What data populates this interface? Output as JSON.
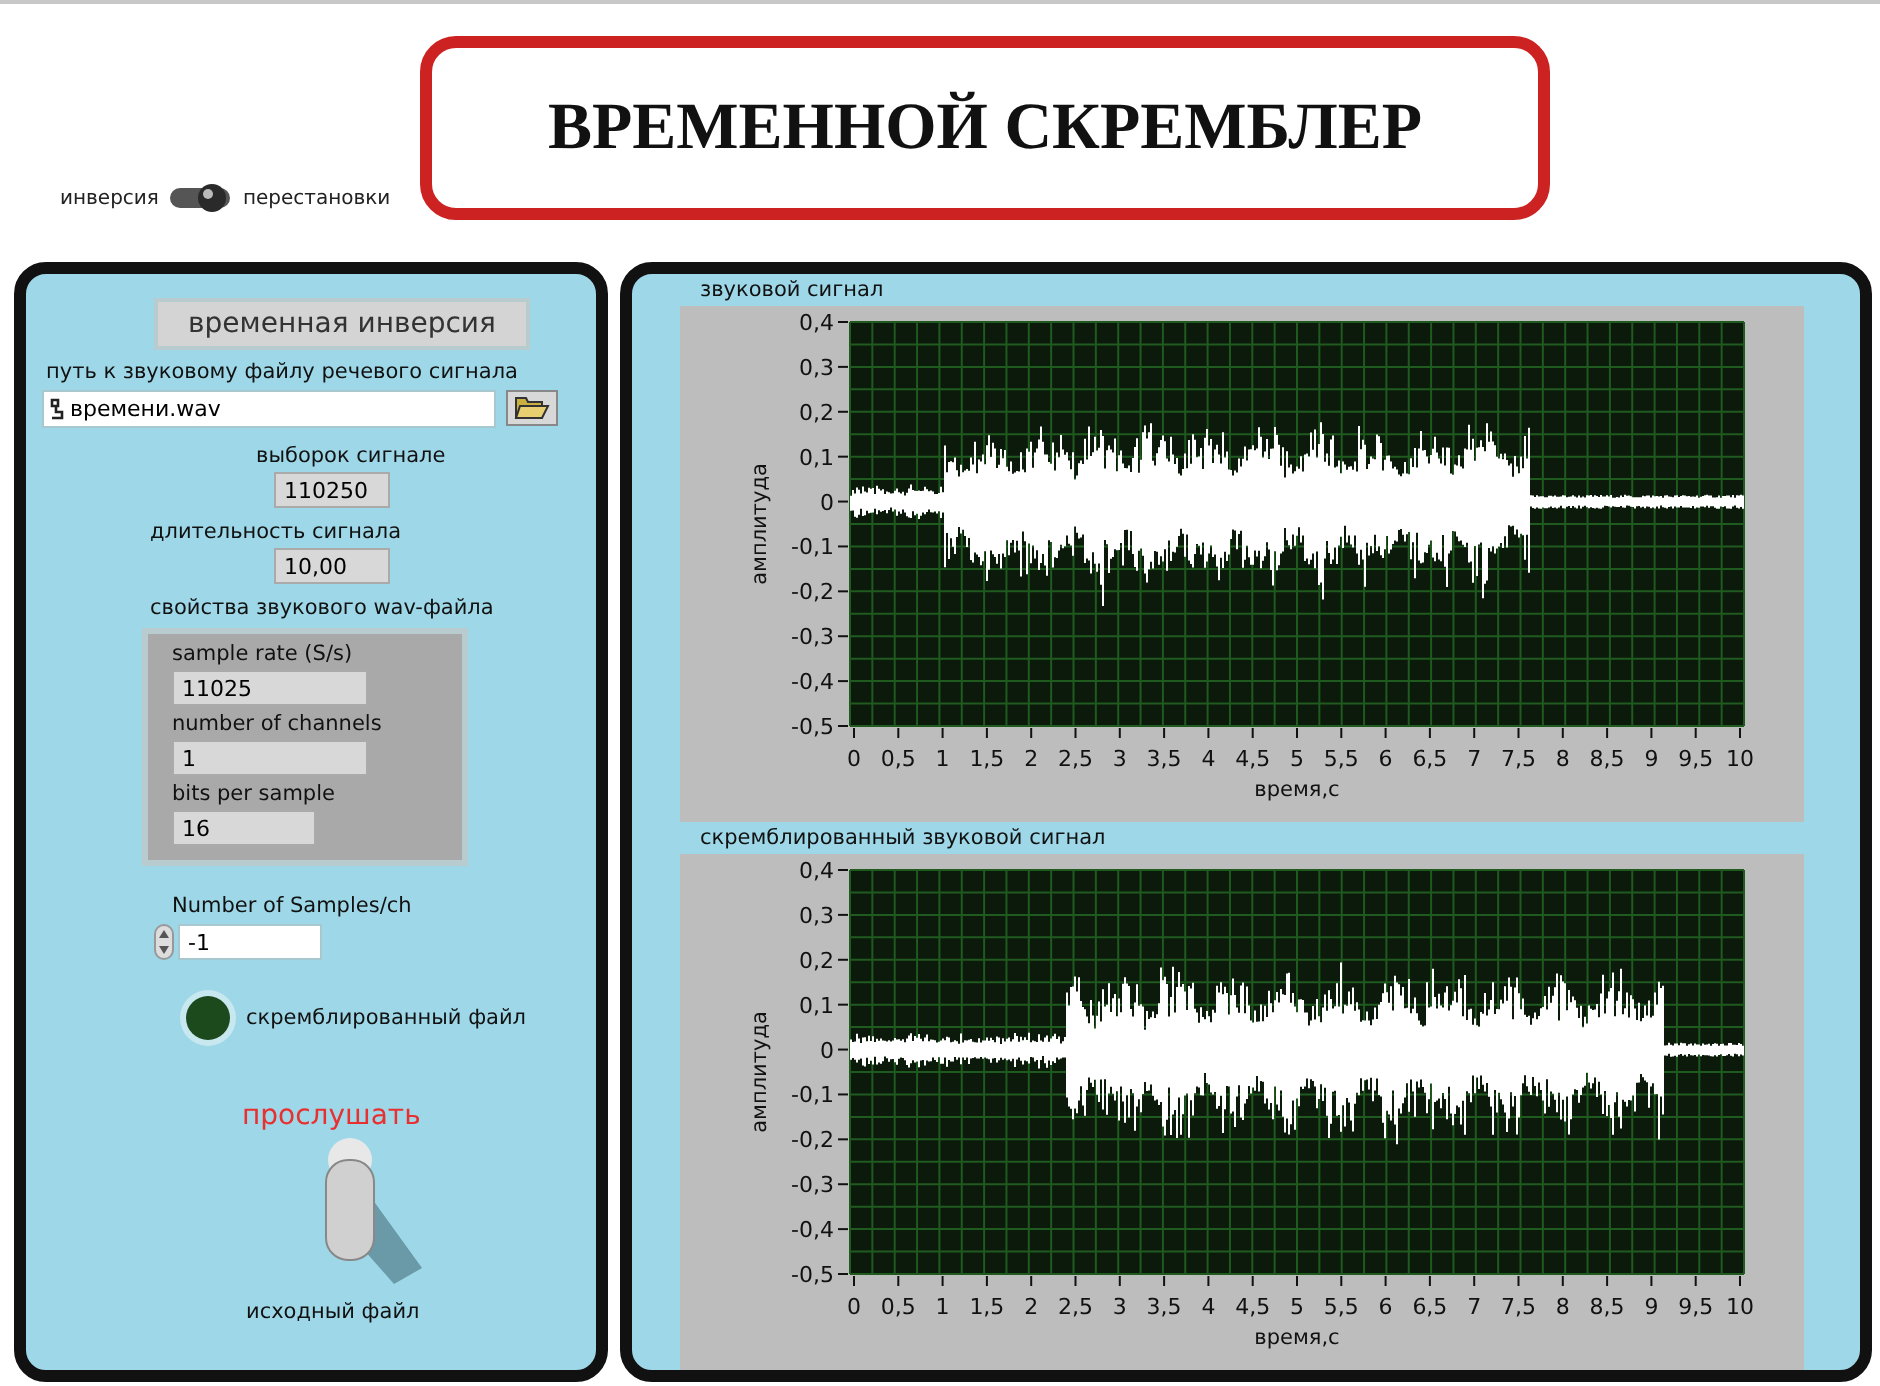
{
  "switch_mode": {
    "left_label": "инверсия",
    "right_label": "перестановки",
    "on": true
  },
  "title": "ВРЕМЕННОЙ СКРЕМБЛЕР",
  "left_panel": {
    "mode_display": "временная инверсия",
    "path": {
      "label": "путь к звуковому файлу речевого сигнала",
      "value": "времени.wav"
    },
    "samples": {
      "label": "выборок сигнале",
      "value": "110250"
    },
    "duration": {
      "label": "длительность сигнала",
      "value": "10,00"
    },
    "wav_properties": {
      "label": "свойства звукового wav-файла",
      "fields": [
        {
          "label": "sample rate (S/s)",
          "value": "11025"
        },
        {
          "label": "number of channels",
          "value": "1"
        },
        {
          "label": "bits per sample",
          "value": "16"
        }
      ]
    },
    "samples_per_channel": {
      "label": "Number of Samples/ch",
      "value": "-1"
    },
    "led": {
      "label": "скремблированный файл",
      "on": false
    },
    "play_switch": {
      "top_label": "прослушать",
      "bottom_label": "исходный файл",
      "on": true
    }
  },
  "graphs": [
    {
      "title": "звуковой сигнал",
      "xlabel": "время,с",
      "ylabel": "амплитуда",
      "xticks": [
        "0",
        "0,5",
        "1",
        "1,5",
        "2",
        "2,5",
        "3",
        "3,5",
        "4",
        "4,5",
        "5",
        "5,5",
        "6",
        "6,5",
        "7",
        "7,5",
        "8",
        "8,5",
        "9",
        "9,5",
        "10"
      ],
      "yticks": [
        "0,4",
        "0,3",
        "0,2",
        "0,1",
        "0",
        "-0,1",
        "-0,2",
        "-0,3",
        "-0,4",
        "-0,5"
      ]
    },
    {
      "title": "скремблированный звуковой сигнал",
      "xlabel": "время,с",
      "ylabel": "амплитуда",
      "xticks": [
        "0",
        "0,5",
        "1",
        "1,5",
        "2",
        "2,5",
        "3",
        "3,5",
        "4",
        "4,5",
        "5",
        "5,5",
        "6",
        "6,5",
        "7",
        "7,5",
        "8",
        "8,5",
        "9",
        "9,5",
        "10"
      ],
      "yticks": [
        "0,4",
        "0,3",
        "0,2",
        "0,1",
        "0",
        "-0,1",
        "-0,2",
        "-0,3",
        "-0,4",
        "-0,5"
      ]
    }
  ]
}
